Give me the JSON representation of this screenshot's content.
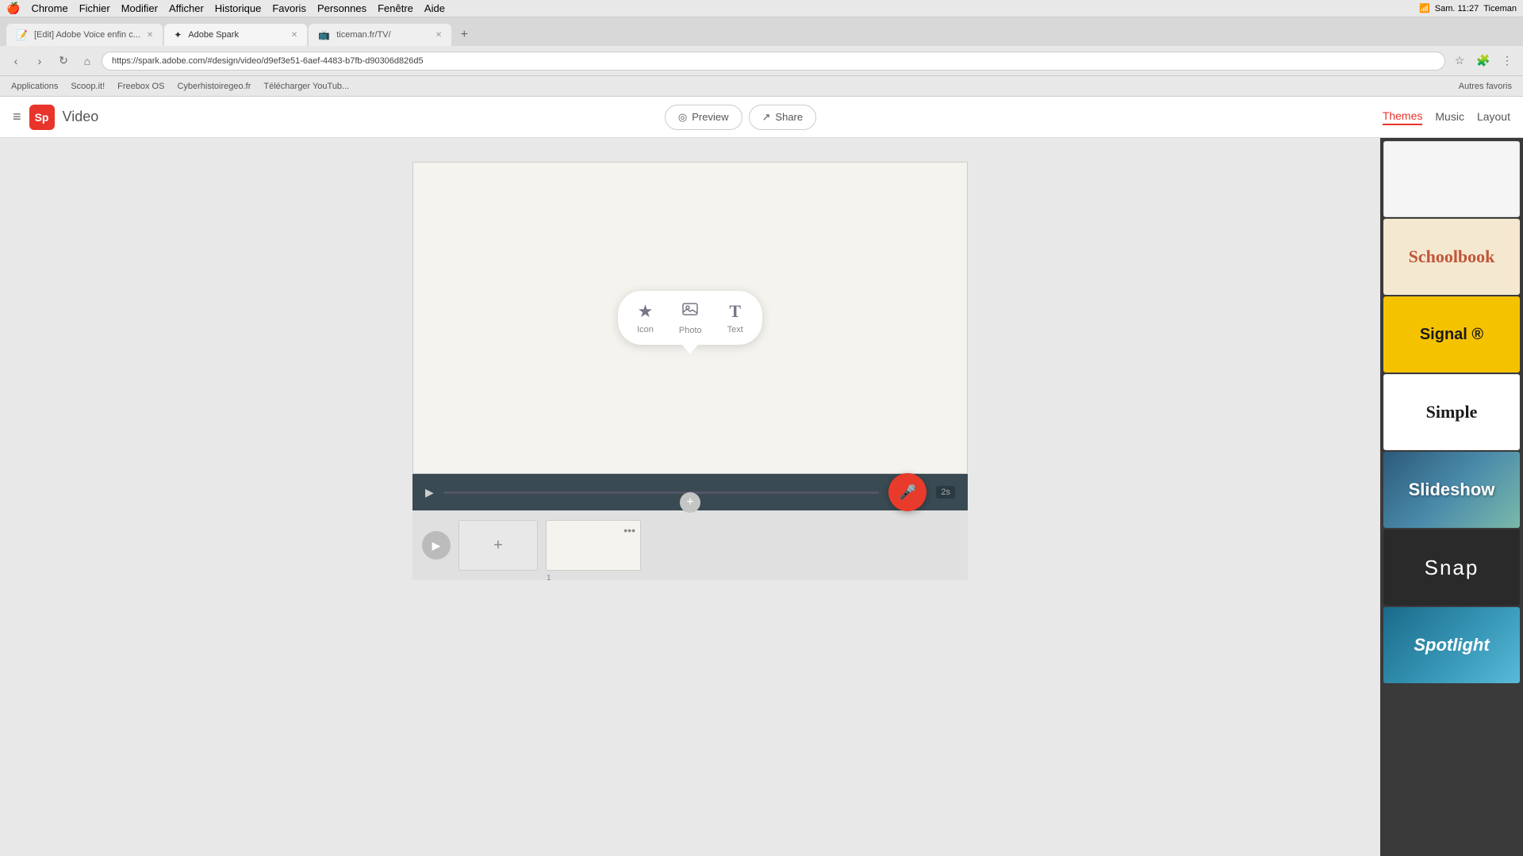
{
  "os": {
    "menubar": {
      "apple": "🍎",
      "menus": [
        "Chrome",
        "Fichier",
        "Modifier",
        "Afficher",
        "Historique",
        "Favoris",
        "Personnes",
        "Fenêtre",
        "Aide"
      ],
      "time": "Sam. 11:27",
      "user": "Ticeman"
    }
  },
  "browser": {
    "tabs": [
      {
        "id": "tab1",
        "favicon": "",
        "title": "[Edit] Adobe Voice enfin c...",
        "active": false
      },
      {
        "id": "tab2",
        "favicon": "",
        "title": "Adobe Spark",
        "active": true
      },
      {
        "id": "tab3",
        "favicon": "",
        "title": "ticeman.fr/TV/",
        "active": false
      }
    ],
    "url": "https://spark.adobe.com/#design/video/d9ef3e51-6aef-4483-b7fb-d90306d826d5",
    "bookmarks": [
      "Applications",
      "Scoop.it!",
      "Freebox OS",
      "Cyberhistoiregeo.fr",
      "Télécharger YouTub...",
      "Autres favoris"
    ]
  },
  "app": {
    "title": "Video",
    "logo_letter": "Sp",
    "header_tabs": [
      {
        "id": "themes",
        "label": "Themes",
        "active": true
      },
      {
        "id": "music",
        "label": "Music",
        "active": false
      },
      {
        "id": "layout",
        "label": "Layout",
        "active": false
      }
    ],
    "preview_label": "Preview",
    "share_label": "Share"
  },
  "canvas": {
    "tools": [
      {
        "id": "icon",
        "icon": "★",
        "label": "Icon"
      },
      {
        "id": "photo",
        "icon": "🖼",
        "label": "Photo"
      },
      {
        "id": "text",
        "icon": "T",
        "label": "Text"
      }
    ]
  },
  "timeline": {
    "time": "2s"
  },
  "slides": [
    {
      "id": "add",
      "type": "add",
      "symbol": "+"
    },
    {
      "id": "slide1",
      "type": "thumb",
      "number": "1"
    }
  ],
  "themes": [
    {
      "id": "blank",
      "label": "",
      "style": "blank"
    },
    {
      "id": "schoolbook",
      "label": "Schoolbook",
      "style": "schoolbook"
    },
    {
      "id": "signal",
      "label": "Signal ®",
      "style": "signal"
    },
    {
      "id": "simple",
      "label": "Simple",
      "style": "simple"
    },
    {
      "id": "slideshow",
      "label": "Slideshow",
      "style": "slideshow"
    },
    {
      "id": "snap",
      "label": "Snap",
      "style": "snap"
    },
    {
      "id": "spotlight",
      "label": "Spotlight",
      "style": "spotlight"
    }
  ]
}
